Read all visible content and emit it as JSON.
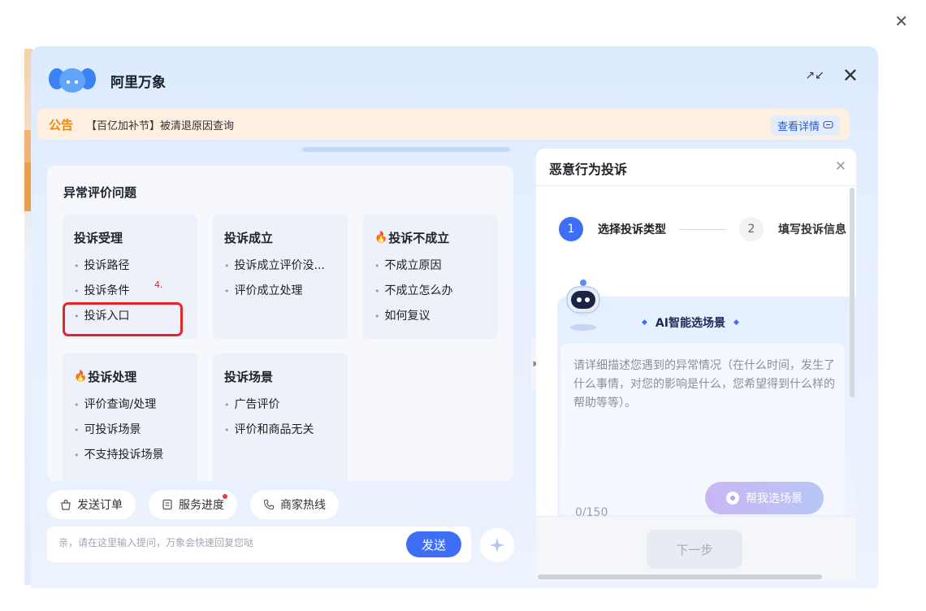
{
  "header": {
    "brand": "阿里万象",
    "minimize_glyph": "↗↙",
    "close_glyph": "✕"
  },
  "outer_close_glyph": "✕",
  "notice": {
    "tag": "公告",
    "text": "【百亿加补节】被清退原因查询",
    "link": "查看详情"
  },
  "card": {
    "title": "异常评价问题",
    "categories": [
      {
        "title": "投诉受理",
        "fire": false,
        "items": [
          "投诉路径",
          "投诉条件",
          "投诉入口"
        ]
      },
      {
        "title": "投诉成立",
        "fire": false,
        "items": [
          "投诉成立评价没...",
          "评价成立处理"
        ]
      },
      {
        "title": "投诉不成立",
        "fire": true,
        "items": [
          "不成立原因",
          "不成立怎么办",
          "如何复议"
        ]
      },
      {
        "title": "投诉处理",
        "fire": true,
        "items": [
          "评价查询/处理",
          "可投诉场景",
          "不支持投诉场景"
        ]
      },
      {
        "title": "投诉场景",
        "fire": false,
        "items": [
          "广告评价",
          "评价和商品无关"
        ]
      }
    ],
    "step_marker": "4."
  },
  "chips": [
    {
      "label": "发送订单",
      "icon": "bag-icon"
    },
    {
      "label": "服务进度",
      "icon": "document-icon",
      "badge": true
    },
    {
      "label": "商家热线",
      "icon": "phone-icon"
    }
  ],
  "input": {
    "placeholder": "亲，请在这里输入提问，万象会快速回复您哒",
    "send_label": "发送"
  },
  "panel": {
    "title": "恶意行为投诉",
    "steps": [
      {
        "num": "1",
        "label": "选择投诉类型",
        "active": true
      },
      {
        "num": "2",
        "label": "填写投诉信息",
        "active": false
      }
    ],
    "ai": {
      "title": "AI智能选场景",
      "placeholder": "请详细描述您遇到的异常情况（在什么时间，发生了什么事情，对您的影响是什么，您希望得到什么样的帮助等等）。",
      "counter": "0/150",
      "help_label": "帮我选场景"
    },
    "next_label": "下一步"
  },
  "colors": {
    "accent": "#3d6ef5",
    "notice_tag": "#f0870b",
    "highlight": "#e4262b"
  }
}
